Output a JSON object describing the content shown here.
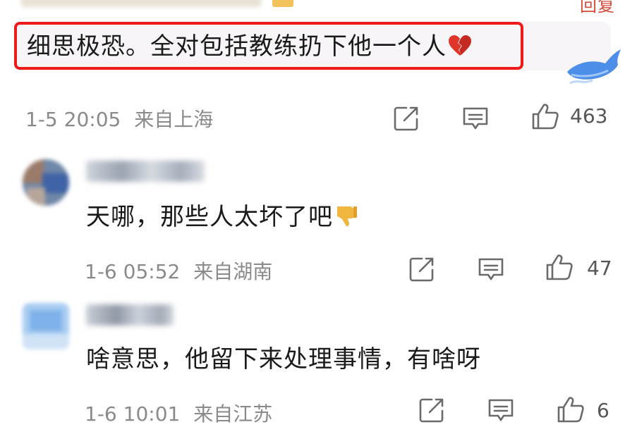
{
  "top": {
    "cropped_label": "回复"
  },
  "comments": [
    {
      "text": "细思极恐。全对包括教练扔下他一个人",
      "emoji": "broken-heart-icon",
      "date": "1-5 20:05",
      "location": "来自上海",
      "likes": "463"
    },
    {
      "username": "",
      "text": "天哪，那些人太坏了吧",
      "emoji": "thumbs-down-icon",
      "date": "1-6 05:52",
      "location": "来自湖南",
      "likes": "47"
    },
    {
      "username": "",
      "text": "啥意思，他留下来处理事情，有啥呀",
      "date": "1-6 10:01",
      "location": "来自江苏",
      "likes": "6"
    }
  ],
  "colors": {
    "highlight_border": "#ee1b1b",
    "meta_text": "#8a8a8a",
    "bubble_bg": "#f7f5f8"
  }
}
